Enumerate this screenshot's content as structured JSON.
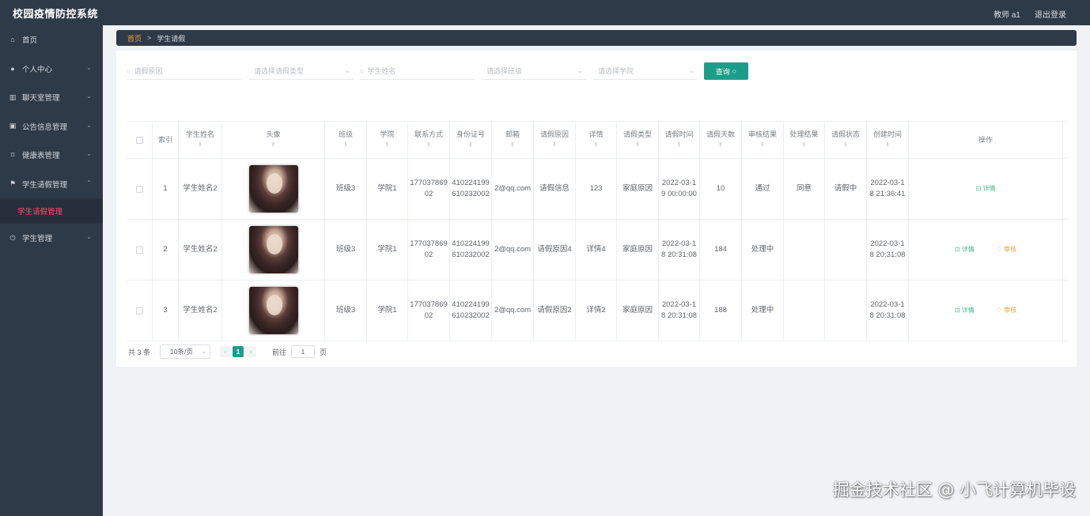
{
  "app": {
    "title": "校园疫情防控系统"
  },
  "header": {
    "user": "教师 a1",
    "logout": "退出登录"
  },
  "sidebar": {
    "items": [
      {
        "label": "首页",
        "icon": "home-icon",
        "glyph": "⌂"
      },
      {
        "label": "个人中心",
        "icon": "user-icon",
        "glyph": "●",
        "arrow": "⌄"
      },
      {
        "label": "聊天室管理",
        "icon": "chat-icon",
        "glyph": "▥",
        "arrow": "⌄"
      },
      {
        "label": "公告信息管理",
        "icon": "notice-icon",
        "glyph": "▣",
        "arrow": "⌄"
      },
      {
        "label": "健康表管理",
        "icon": "health-icon",
        "glyph": "⌑",
        "arrow": "⌄"
      },
      {
        "label": "学生请假管理",
        "icon": "flag-icon",
        "glyph": "⚑",
        "arrow": "⌃"
      },
      {
        "label": "学生管理",
        "icon": "power-icon",
        "glyph": "⏻",
        "arrow": "⌄"
      }
    ],
    "sub_item": "学生请假管理"
  },
  "breadcrumb": {
    "home": "首页",
    "sep": ">",
    "current": "学生请假"
  },
  "search": {
    "reason_placeholder": "请假原因",
    "type_placeholder": "请选择请假类型",
    "name_placeholder": "学生姓名",
    "class_placeholder": "请选择班级",
    "college_placeholder": "请选择学院",
    "button": "查询",
    "search_glyph": "○",
    "caret_glyph": "⌄"
  },
  "table": {
    "headers": [
      "索引",
      "学生姓名",
      "头像",
      "班级",
      "学院",
      "联系方式",
      "身份证号",
      "邮箱",
      "请假原因",
      "详情",
      "请假类型",
      "请假时间",
      "请假天数",
      "审核结果",
      "处理结果",
      "请假状态",
      "创建时间",
      "操作"
    ],
    "sort_glyph": "⇕",
    "rows": [
      {
        "index": "1",
        "name": "学生姓名2",
        "class": "班级3",
        "college": "学院1",
        "phone": "17703786902",
        "id_card": "410224199610232002",
        "email": "2@qq.com",
        "reason": "请假信息",
        "detail": "123",
        "type": "家庭原因",
        "leave_time": "2022-03-19 00:00:00",
        "days": "10",
        "audit": "通过",
        "handle": "同意",
        "status": "请假中",
        "created": "2022-03-18 21:36:41",
        "op_detail": "⊡ 详情",
        "op_audit": ""
      },
      {
        "index": "2",
        "name": "学生姓名2",
        "class": "班级3",
        "college": "学院1",
        "phone": "17703786902",
        "id_card": "410224199610232002",
        "email": "2@qq.com",
        "reason": "请假原因4",
        "detail": "详情4",
        "type": "家庭原因",
        "leave_time": "2022-03-18 20:31:08",
        "days": "184",
        "audit": "处理中",
        "handle": "",
        "status": "",
        "created": "2022-03-18 20:31:08",
        "op_detail": "⊡ 详情",
        "op_audit": "♢ 审核"
      },
      {
        "index": "3",
        "name": "学生姓名2",
        "class": "班级3",
        "college": "学院1",
        "phone": "17703786902",
        "id_card": "410224199610232002",
        "email": "2@qq.com",
        "reason": "请假原因2",
        "detail": "详情2",
        "type": "家庭原因",
        "leave_time": "2022-03-18 20:31:08",
        "days": "188",
        "audit": "处理中",
        "handle": "",
        "status": "",
        "created": "2022-03-18 20:31:08",
        "op_detail": "⊡ 详情",
        "op_audit": "♢ 审核"
      }
    ]
  },
  "pagination": {
    "total": "共 3 条",
    "page_size": "10条/页",
    "prev": "‹",
    "current": "1",
    "next": "›",
    "goto_label": "前往",
    "goto_value": "1",
    "goto_suffix": "页"
  },
  "watermark": "掘金技术社区 @ 小飞计算机毕设",
  "colors": {
    "sidebar_bg": "#2f3a48",
    "accent": "#1b9d8a",
    "active_menu": "#ff4d6a",
    "breadcrumb_home": "#f0a040",
    "detail_link": "#42b983",
    "audit_link": "#e6a23c"
  }
}
